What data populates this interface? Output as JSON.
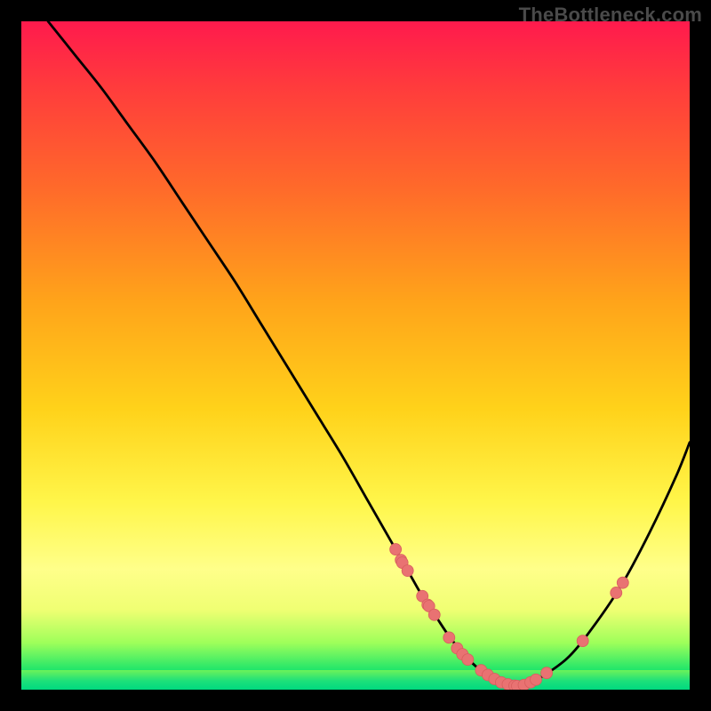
{
  "watermark": "TheBottleneck.com",
  "colors": {
    "background": "#000000",
    "curve": "#000000",
    "dot": "#e97272",
    "gradient_top": "#ff1a4d",
    "gradient_bottom": "#00d97a"
  },
  "chart_data": {
    "type": "line",
    "title": "",
    "xlabel": "",
    "ylabel": "",
    "xlim": [
      0,
      100
    ],
    "ylim": [
      0,
      100
    ],
    "grid": false,
    "legend": false,
    "series": [
      {
        "name": "bottleneck_curve",
        "x": [
          4,
          8,
          12,
          16,
          20,
          24,
          28,
          32,
          36,
          40,
          44,
          48,
          52,
          56,
          58,
          60,
          62,
          64,
          66,
          68,
          70,
          72,
          74,
          76,
          78,
          82,
          86,
          90,
          94,
          98,
          100
        ],
        "y": [
          100,
          95,
          90,
          84.5,
          79,
          73,
          67,
          61,
          54.5,
          48,
          41.5,
          35,
          28,
          21,
          17.5,
          14,
          11,
          8,
          5.5,
          3.5,
          2,
          1,
          0.5,
          1,
          2,
          5,
          10,
          16,
          23.5,
          32,
          37
        ]
      }
    ],
    "markers": [
      {
        "x": 56.0,
        "y": 21.0
      },
      {
        "x": 56.8,
        "y": 19.4
      },
      {
        "x": 57.0,
        "y": 19.0
      },
      {
        "x": 57.8,
        "y": 17.8
      },
      {
        "x": 60.0,
        "y": 14.0
      },
      {
        "x": 60.8,
        "y": 12.7
      },
      {
        "x": 61.0,
        "y": 12.5
      },
      {
        "x": 61.8,
        "y": 11.2
      },
      {
        "x": 64.0,
        "y": 7.8
      },
      {
        "x": 65.2,
        "y": 6.2
      },
      {
        "x": 66.0,
        "y": 5.3
      },
      {
        "x": 66.8,
        "y": 4.5
      },
      {
        "x": 68.8,
        "y": 2.9
      },
      {
        "x": 69.8,
        "y": 2.2
      },
      {
        "x": 70.8,
        "y": 1.6
      },
      {
        "x": 71.8,
        "y": 1.1
      },
      {
        "x": 72.8,
        "y": 0.8
      },
      {
        "x": 73.8,
        "y": 0.6
      },
      {
        "x": 74.2,
        "y": 0.55
      },
      {
        "x": 75.2,
        "y": 0.7
      },
      {
        "x": 76.2,
        "y": 1.1
      },
      {
        "x": 77.0,
        "y": 1.5
      },
      {
        "x": 78.6,
        "y": 2.5
      },
      {
        "x": 84.0,
        "y": 7.3
      },
      {
        "x": 89.0,
        "y": 14.5
      },
      {
        "x": 90.0,
        "y": 16.0
      }
    ]
  }
}
